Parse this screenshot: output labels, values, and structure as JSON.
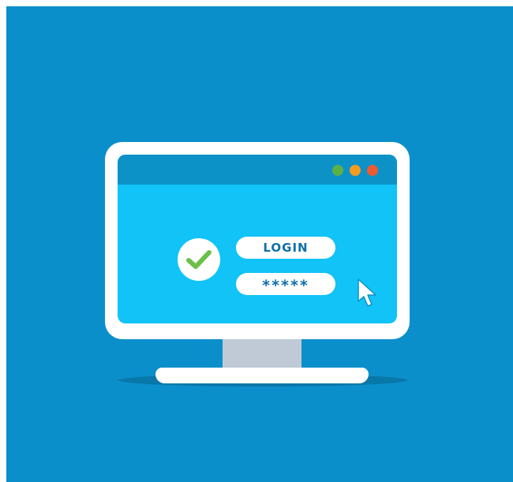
{
  "login_form": {
    "login_label": "LOGIN",
    "password_mask": "*****"
  },
  "window_controls": [
    "green-dot",
    "orange-dot",
    "red-dot"
  ],
  "icons": {
    "check": "checkmark-icon",
    "cursor": "mouse-pointer-icon"
  },
  "colors": {
    "background": "#0b8fcb",
    "screen": "#11c3f6",
    "titlebar": "#0d92c8",
    "check_green": "#6cc04a",
    "text_blue": "#0f6fa8"
  }
}
